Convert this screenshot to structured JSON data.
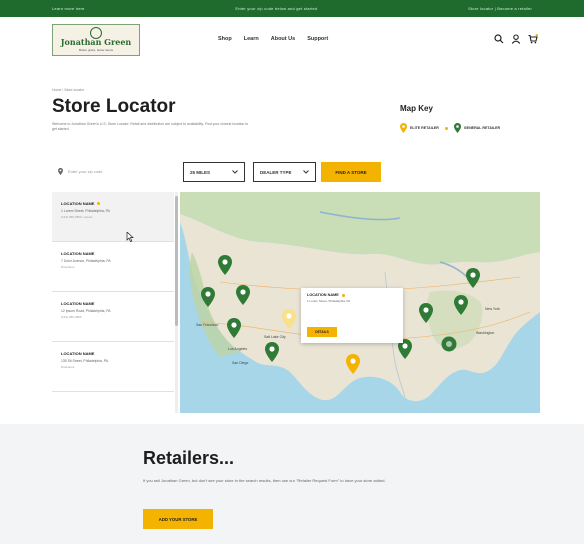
{
  "topbar": {
    "left": "Learn more here",
    "center": "Enter your zip code below and get started",
    "right": "Store locator  |  Become a retailer"
  },
  "header": {
    "logo_text": "Jonathan Green",
    "logo_sub": "Better grass, better lawns",
    "nav": [
      "Shop",
      "Learn",
      "About Us",
      "Support"
    ],
    "icons": [
      "search-icon",
      "account-icon",
      "cart-icon"
    ]
  },
  "breadcrumb": "Home / Store locator",
  "title": "Store Locator",
  "description": "Welcome to Jonathan Green's U.S. Store Locator. Retail and distribution are subject to availability. Find your closest location to get started.",
  "map_key": {
    "title": "Map Key",
    "elite": "ELITE RETAILER",
    "general": "GENERAL RETAILER"
  },
  "search": {
    "zip_placeholder": "Enter your zip code",
    "distance": "25 MILES",
    "dealer_type": "DEALER TYPE",
    "find_button": "FIND A STORE"
  },
  "locations": [
    {
      "name": "LOCATION NAME",
      "address": "1 Lorem Street, Philadelphia, PA",
      "extra": "(123) 456-7890 • Hours",
      "elite": true
    },
    {
      "name": "LOCATION NAME",
      "address": "7 Dolor Avenue, Philadelphia, PA",
      "extra": "Directions",
      "elite": false
    },
    {
      "name": "LOCATION NAME",
      "address": "12 Ipsum Road, Philadelphia, PA",
      "extra": "(123) 456-7890",
      "elite": false
    },
    {
      "name": "LOCATION NAME",
      "address": "135 Sit Street, Philadelphia, PA",
      "extra": "Directions",
      "elite": false
    }
  ],
  "popup": {
    "name": "LOCATION NAME",
    "address": "1 Lorem Street, Philadelphia, PA",
    "button": "DETAILS"
  },
  "map_labels": {
    "sf": "San Francisco",
    "la": "Los Angeles",
    "sd": "San Diego",
    "slc": "Salt Lake City",
    "ny": "New York",
    "dc": "Washington"
  },
  "retailers": {
    "title": "Retailers...",
    "description": "If you sell Jonathan Green, but don't see your store in the search results, then use our \"Retailer Request Form\" to have your store added.",
    "button": "ADD YOUR STORE"
  },
  "colors": {
    "brand_green": "#1f6b2e",
    "accent_yellow": "#f5b301",
    "pin_green": "#2f7a36"
  }
}
